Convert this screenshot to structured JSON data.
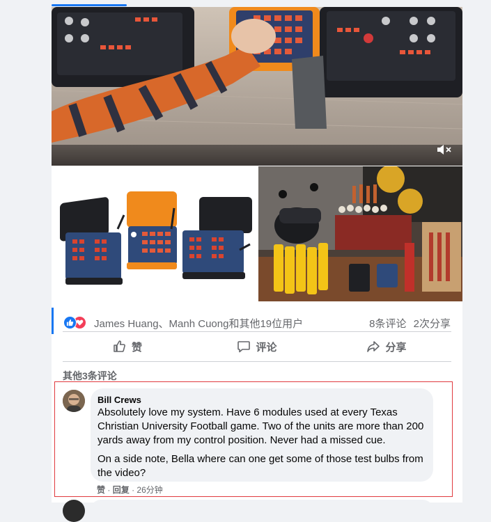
{
  "reactions": {
    "names": "James Huang、Manh Cuong和其他19位用户",
    "comment_count": "8条评论",
    "share_count": "2次分享"
  },
  "actions": {
    "like_label": "赞",
    "comment_label": "评论",
    "share_label": "分享"
  },
  "comments": {
    "more_label": "其他3条评论",
    "items": [
      {
        "author": "Bill Crews",
        "paragraph_1": "Absolutely love my system. Have 6 modules used at every Texas Christian University Football game. Two of the units are more than 200 yards away from my control position. Never had a missed cue.",
        "paragraph_2": "On a side note, Bella where can one get some of those test bulbs from the video?",
        "like_action": "赞",
        "reply_action": "回复",
        "separator": "·",
        "time": "26分钟"
      }
    ]
  },
  "icons": {
    "mute": "volume-muted-icon",
    "like_reaction": "like-reaction-icon",
    "love_reaction": "love-reaction-icon"
  },
  "colors": {
    "brand_blue": "#1877f2",
    "love_red": "#f33e58",
    "highlight_red": "#e0393e",
    "muted_text": "#65676b"
  }
}
